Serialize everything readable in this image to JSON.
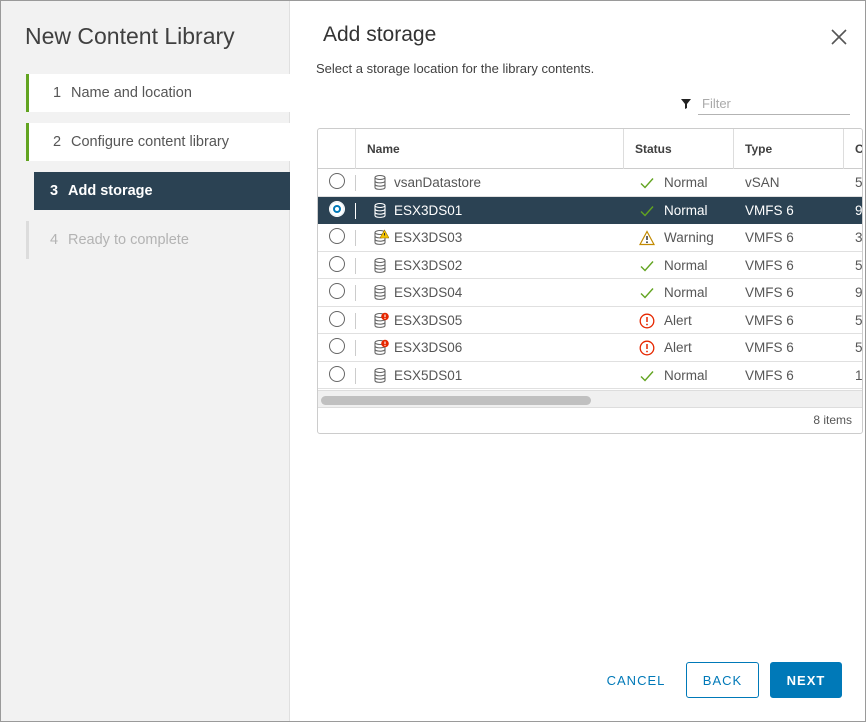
{
  "sidebar": {
    "title": "New Content Library",
    "steps": [
      {
        "num": "1",
        "label": "Name and location"
      },
      {
        "num": "2",
        "label": "Configure content library"
      },
      {
        "num": "3",
        "label": "Add storage"
      },
      {
        "num": "4",
        "label": "Ready to complete"
      }
    ]
  },
  "main": {
    "title": "Add storage",
    "subtitle": "Select a storage location for the library contents.",
    "filter_placeholder": "Filter"
  },
  "grid": {
    "headers": {
      "name": "Name",
      "status": "Status",
      "type": "Type",
      "capacity": "C"
    },
    "rows": [
      {
        "name": "vsanDatastore",
        "status": "Normal",
        "status_icon": "check-icon",
        "type": "vSAN",
        "capacity": "5",
        "selected": false
      },
      {
        "name": "ESX3DS01",
        "status": "Normal",
        "status_icon": "check-icon",
        "type": "VMFS 6",
        "capacity": "9",
        "selected": true
      },
      {
        "name": "ESX3DS03",
        "status": "Warning",
        "status_icon": "warning-icon",
        "type": "VMFS 6",
        "capacity": "3",
        "selected": false
      },
      {
        "name": "ESX3DS02",
        "status": "Normal",
        "status_icon": "check-icon",
        "type": "VMFS 6",
        "capacity": "5",
        "selected": false
      },
      {
        "name": "ESX3DS04",
        "status": "Normal",
        "status_icon": "check-icon",
        "type": "VMFS 6",
        "capacity": "9",
        "selected": false
      },
      {
        "name": "ESX3DS05",
        "status": "Alert",
        "status_icon": "alert-icon",
        "type": "VMFS 6",
        "capacity": "5",
        "selected": false
      },
      {
        "name": "ESX3DS06",
        "status": "Alert",
        "status_icon": "alert-icon",
        "type": "VMFS 6",
        "capacity": "5",
        "selected": false
      },
      {
        "name": "ESX5DS01",
        "status": "Normal",
        "status_icon": "check-icon",
        "type": "VMFS 6",
        "capacity": "1.",
        "selected": false
      }
    ],
    "item_count": "8 items"
  },
  "buttons": {
    "cancel": "CANCEL",
    "back": "BACK",
    "next": "NEXT"
  },
  "colors": {
    "accent": "#0079b8",
    "selected_row": "#2b4253",
    "step_done": "#62a420",
    "ok": "#62a420",
    "warning": "#e8a400",
    "alert": "#e62700"
  }
}
